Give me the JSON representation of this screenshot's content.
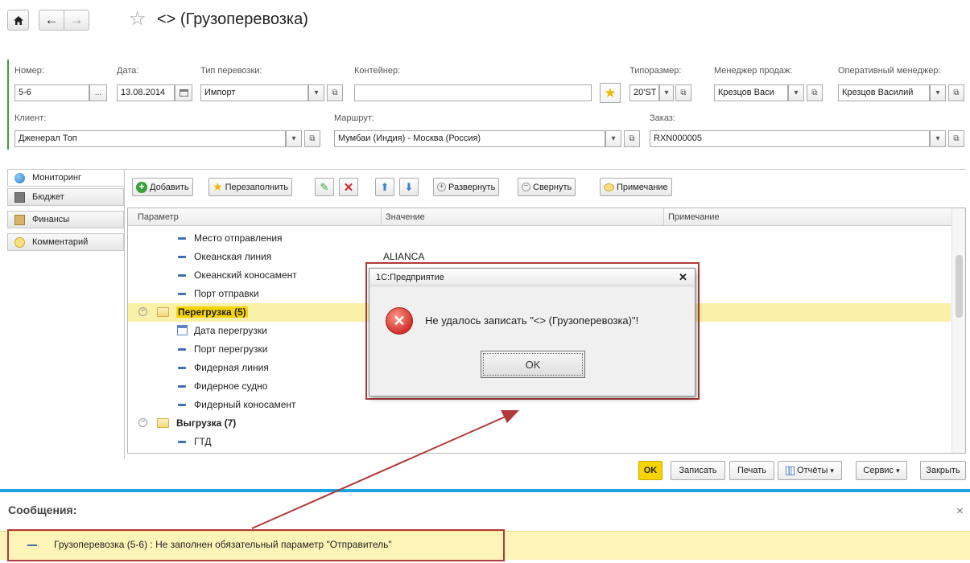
{
  "window": {
    "title": "<> (Грузоперевозка)"
  },
  "nav": {
    "home_icon": "home-icon",
    "back_icon": "arrow-left-icon",
    "forward_icon": "arrow-right-icon",
    "favorite_icon": "star-outline-icon"
  },
  "header": {
    "number_label": "Номер:",
    "number_value": "5-6",
    "date_label": "Дата:",
    "date_value": "13.08.2014",
    "transport_type_label": "Тип перевозки:",
    "transport_type_value": "Импорт",
    "container_label": "Контейнер:",
    "container_value": "",
    "size_label": "Типоразмер:",
    "size_value": "20'ST",
    "sales_manager_label": "Менеджер продаж:",
    "sales_manager_value": "Крезцов Васи",
    "op_manager_label": "Оперативный менеджер:",
    "op_manager_value": "Крезцов Василий",
    "client_label": "Клиент:",
    "client_value": "Дженерал Топ",
    "route_label": "Маршрут:",
    "route_value": "Мумбаи (Индия) - Москва (Россия)",
    "order_label": "Заказ:",
    "order_value": "RXN000005",
    "dots": "...",
    "dropdown_glyph": "▾",
    "open_glyph": "⧉"
  },
  "tabs": [
    {
      "label": "Мониторинг",
      "icon": "globe-icon",
      "active": true
    },
    {
      "label": "Бюджет",
      "icon": "calculator-icon",
      "active": false
    },
    {
      "label": "Финансы",
      "icon": "money-icon",
      "active": false
    },
    {
      "label": "Комментарий",
      "icon": "speech-bubble-icon",
      "active": false
    }
  ],
  "toolbar": {
    "add": "Добавить",
    "refill": "Перезаполнить",
    "expand": "Развернуть",
    "collapse": "Свернуть",
    "note": "Примечание"
  },
  "grid": {
    "columns": [
      "Параметр",
      "Значение",
      "Примечание"
    ],
    "rows": [
      {
        "param": "Место отправления",
        "value": "",
        "kind": "item",
        "level": 2
      },
      {
        "param": "Океанская линия",
        "value": "ALIANCA",
        "kind": "item",
        "level": 2
      },
      {
        "param": "Океанский коносамент",
        "value": "",
        "kind": "item",
        "level": 2
      },
      {
        "param": "Порт отправки",
        "value": "",
        "kind": "item",
        "level": 2
      },
      {
        "param": "Перегрузка (5)",
        "value": "",
        "kind": "group",
        "level": 1,
        "selected": true
      },
      {
        "param": "Дата перегрузки",
        "value": "",
        "kind": "date",
        "level": 2
      },
      {
        "param": "Порт перегрузки",
        "value": "",
        "kind": "item",
        "level": 2
      },
      {
        "param": "Фидерная линия",
        "value": "",
        "kind": "item",
        "level": 2
      },
      {
        "param": "Фидерное судно",
        "value": "",
        "kind": "item",
        "level": 2
      },
      {
        "param": "Фидерный коносамент",
        "value": "",
        "kind": "item",
        "level": 2
      },
      {
        "param": "Выгрузка (7)",
        "value": "",
        "kind": "group",
        "level": 1
      },
      {
        "param": "ГТД",
        "value": "",
        "kind": "item",
        "level": 2
      }
    ]
  },
  "footer": {
    "ok": "OK",
    "write": "Записать",
    "print": "Печать",
    "reports": "Отчёты",
    "service": "Сервис",
    "close": "Закрыть"
  },
  "dialog": {
    "title": "1С:Предприятие",
    "message": "Не удалось записать \"<> (Грузоперевозка)\"!",
    "ok": "OK",
    "close_glyph": "✕"
  },
  "messages": {
    "title": "Сообщения:",
    "close_glyph": "×",
    "items": [
      {
        "text": "Грузоперевозка (5-6) : Не заполнен обязательный параметр \"Отправитель\""
      }
    ]
  },
  "colors": {
    "accent_blue": "#1ca3e0",
    "highlight_yellow": "#fbf0a8",
    "annotation_red": "#b03a3a"
  }
}
